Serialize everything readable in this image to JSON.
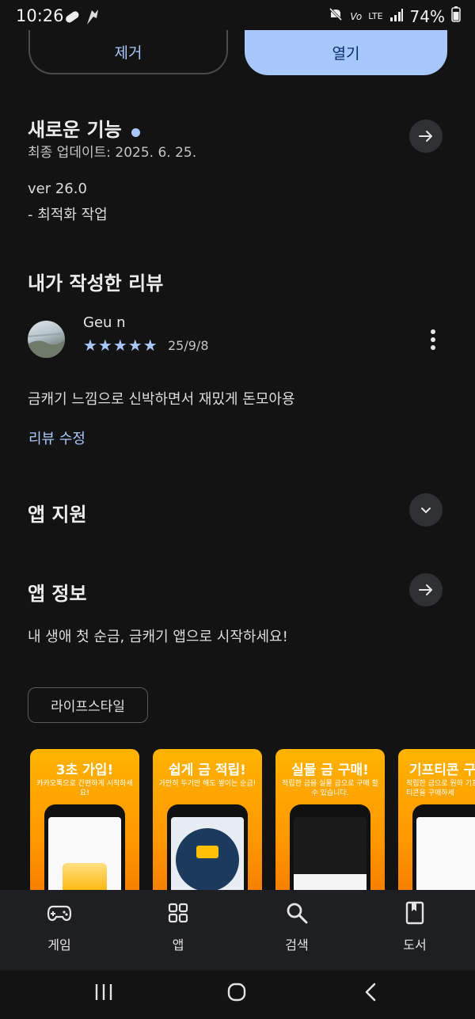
{
  "status_bar": {
    "time": "10:26",
    "network": "LTE",
    "battery": "74%"
  },
  "actions": {
    "remove_label": "제거",
    "open_label": "열기"
  },
  "whats_new": {
    "title": "새로운 기능",
    "last_updated": "최종 업데이트: 2025. 6. 25.",
    "version": "ver 26.0",
    "note": "- 최적화 작업"
  },
  "my_review": {
    "title": "내가 작성한 리뷰",
    "author": "Geu n",
    "stars": "★★★★★",
    "rating": 5,
    "date": "25/9/8",
    "text": "금캐기 느낌으로 신박하면서 재밌게 돈모아용",
    "edit_label": "리뷰 수정"
  },
  "app_support": {
    "title": "앱 지원"
  },
  "app_info": {
    "title": "앱 정보",
    "description": "내 생애 첫 순금, 금캐기 앱으로 시작하세요!",
    "tag": "라이프스타일"
  },
  "screenshots": [
    {
      "title": "3초 가입!",
      "subtitle": "카카오톡으로 간편하게 시작하세요!"
    },
    {
      "title": "쉽게 금 적립!",
      "subtitle": "가만히 두기만 해도 쌓이는 순금!"
    },
    {
      "title": "실물 금 구매!",
      "subtitle": "적립한 금을 실물 금으로 구매 할 수 있습니다."
    },
    {
      "title": "기프티콘 구",
      "subtitle": "적립한 금으로 원하 기프티콘을 구매하세"
    }
  ],
  "bottom_nav": [
    {
      "label": "게임",
      "icon": "gamepad-icon"
    },
    {
      "label": "앱",
      "icon": "apps-grid-icon"
    },
    {
      "label": "검색",
      "icon": "search-icon"
    },
    {
      "label": "도서",
      "icon": "book-icon"
    }
  ]
}
